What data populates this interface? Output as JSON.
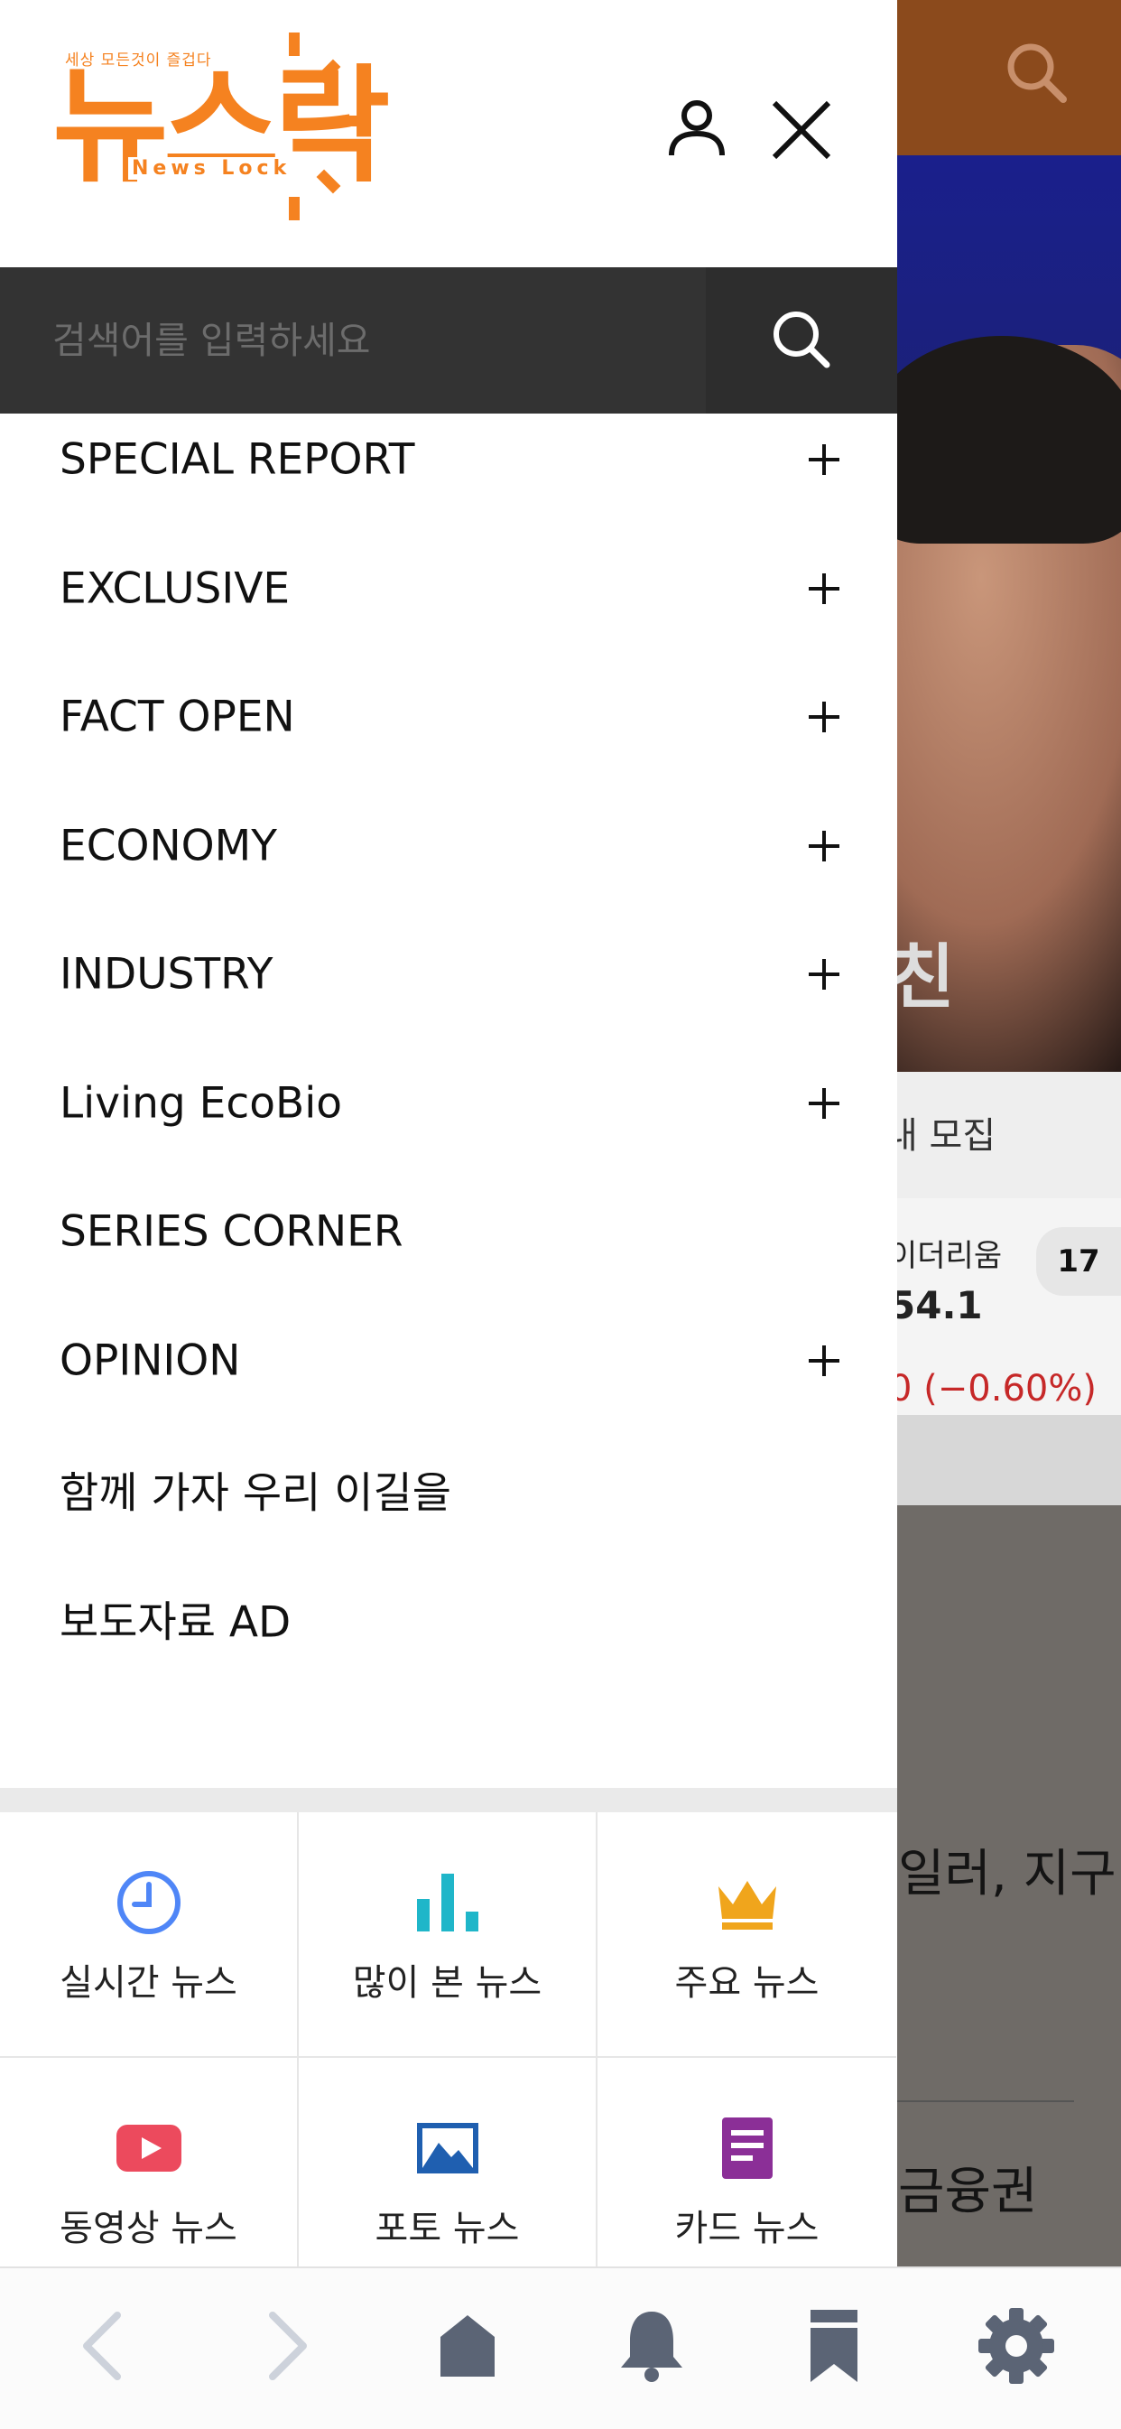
{
  "colors": {
    "brand_orange": "#f58220",
    "search_bar_bg": "#333333",
    "bg_header": "#8b4a1c",
    "ticker_negative": "#c62828",
    "nav_icon": "#5b6475",
    "nav_icon_disabled": "#cdd2db"
  },
  "logo": {
    "tagline": "세상 모든것이 즐겁다",
    "main_text": "뉴스락",
    "sub_text": "News Lock"
  },
  "header": {
    "user_icon": "user-icon",
    "close_icon": "close-icon"
  },
  "search": {
    "placeholder": "검색어를 입력하세요",
    "value": "",
    "icon": "search-icon"
  },
  "menu": {
    "items": [
      {
        "label": "SPECIAL REPORT",
        "expandable": true
      },
      {
        "label": "EXCLUSIVE",
        "expandable": true
      },
      {
        "label": "FACT OPEN",
        "expandable": true
      },
      {
        "label": "ECONOMY",
        "expandable": true
      },
      {
        "label": "INDUSTRY",
        "expandable": true
      },
      {
        "label": "Living EcoBio",
        "expandable": true
      },
      {
        "label": "SERIES CORNER",
        "expandable": false
      },
      {
        "label": "OPINION",
        "expandable": true
      },
      {
        "label": "함께 가자 우리 이길을",
        "expandable": false
      },
      {
        "label": "보도자료 AD",
        "expandable": false
      }
    ]
  },
  "quick_links": [
    {
      "label": "실시간 뉴스",
      "icon": "clock-icon",
      "color": "#4f86f7"
    },
    {
      "label": "많이 본 뉴스",
      "icon": "bar-chart-icon",
      "color": "#1fb6c9"
    },
    {
      "label": "주요 뉴스",
      "icon": "crown-icon",
      "color": "#f0a51c"
    },
    {
      "label": "동영상 뉴스",
      "icon": "play-icon",
      "color": "#ec4a5d"
    },
    {
      "label": "포토 뉴스",
      "icon": "photo-icon",
      "color": "#1f5fb0"
    },
    {
      "label": "카드 뉴스",
      "icon": "card-icon",
      "color": "#8b2f97"
    }
  ],
  "background_page": {
    "hero_char": "친",
    "recruit_text": "내 모집",
    "ticker": {
      "name": "이더리움",
      "price": "54.1",
      "change": "0 (−0.60%)",
      "tv_logo": "17"
    },
    "headline_1": "일러, 지구",
    "headline_2": "금융권"
  },
  "bottom_nav": {
    "items": [
      "back-icon",
      "forward-icon",
      "home-icon",
      "bell-icon",
      "bookmark-icon",
      "settings-icon"
    ]
  }
}
